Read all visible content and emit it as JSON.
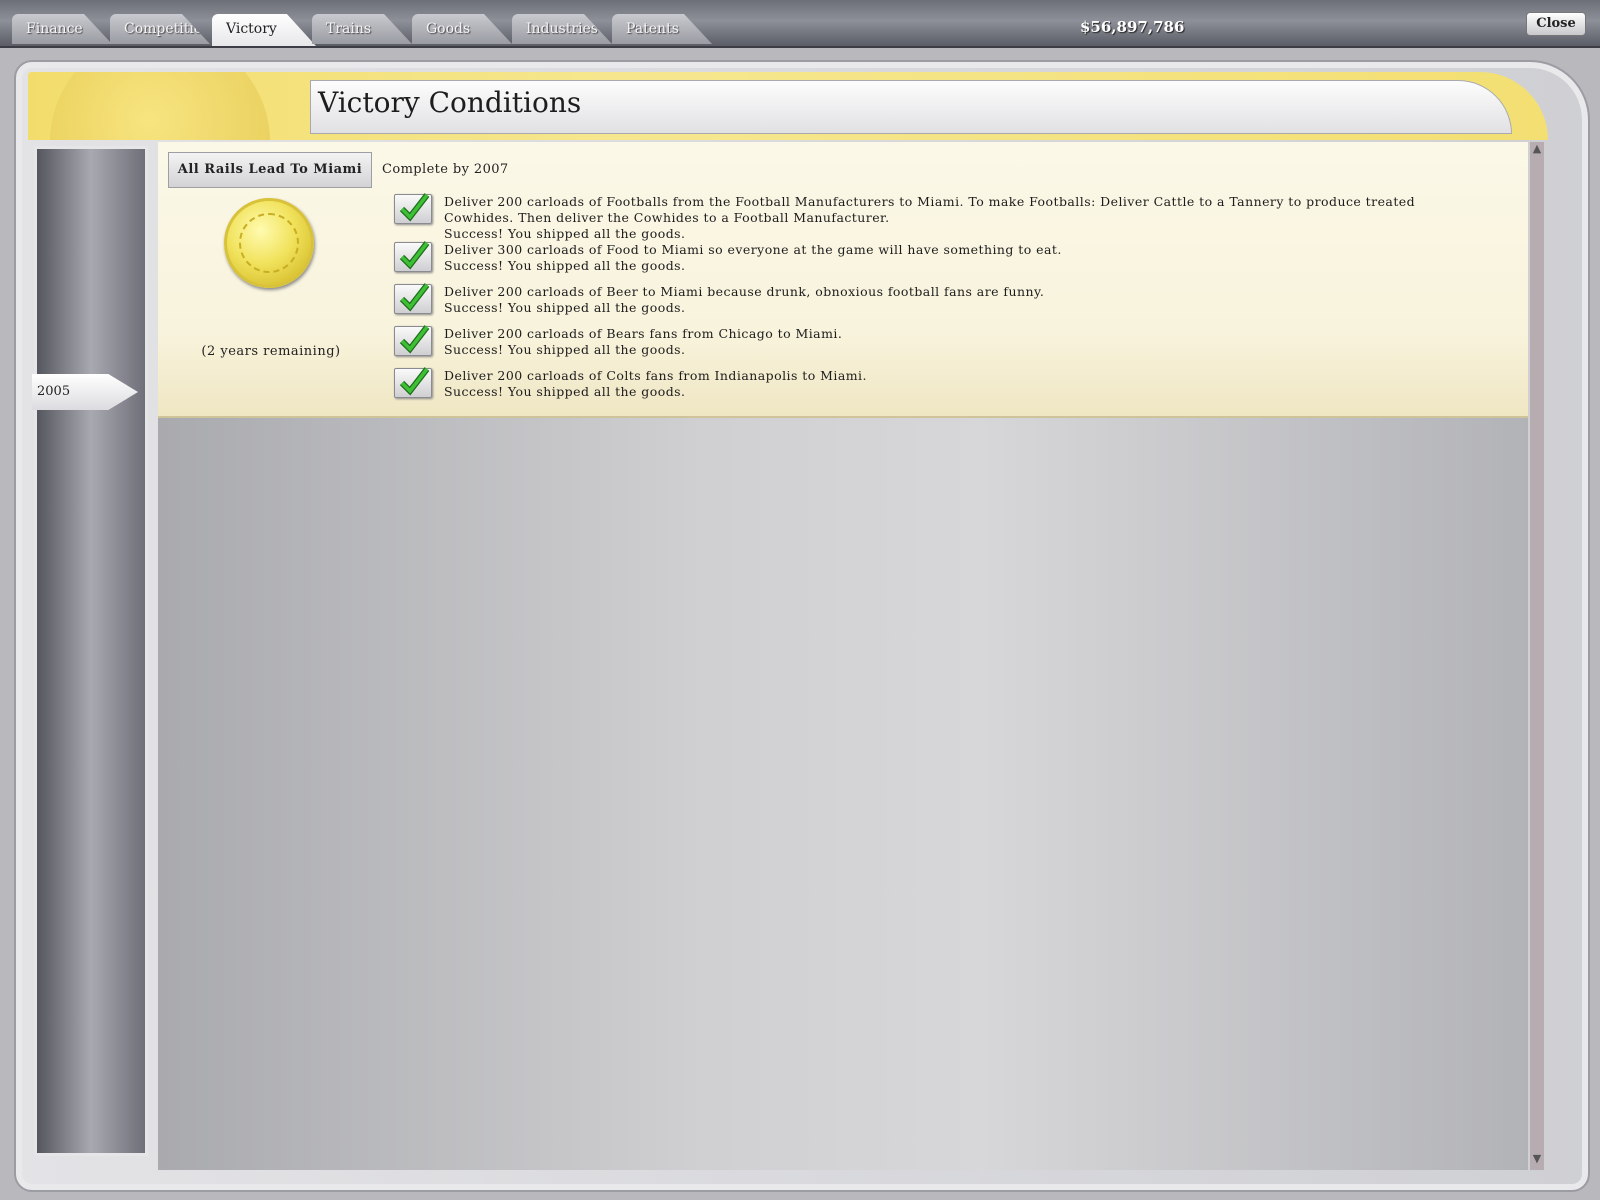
{
  "tabs": [
    {
      "label": "Finance",
      "active": false
    },
    {
      "label": "Competition",
      "active": false
    },
    {
      "label": "Victory",
      "active": true
    },
    {
      "label": "Trains",
      "active": false
    },
    {
      "label": "Goods",
      "active": false
    },
    {
      "label": "Industries",
      "active": false
    },
    {
      "label": "Patents",
      "active": false
    }
  ],
  "header": {
    "money": "$56,897,786",
    "close_label": "Close",
    "title": "Victory Conditions"
  },
  "timeline": {
    "current_year": "2005"
  },
  "scenario": {
    "name": "All Rails Lead To Miami",
    "deadline": "Complete by 2007",
    "remaining": "(2 years remaining)",
    "medal_icon": "gold-medal-icon"
  },
  "conditions": [
    {
      "description": "Deliver 200 carloads of Footballs from the Football Manufacturers to Miami. To make Footballs: Deliver Cattle to a Tannery to produce treated Cowhides. Then deliver the Cowhides to a Football Manufacturer.",
      "status": "Success! You shipped all the goods.",
      "complete": true
    },
    {
      "description": "Deliver 300 carloads of Food to Miami so everyone at the game will have something to eat.",
      "status": "Success! You shipped all the goods.",
      "complete": true
    },
    {
      "description": "Deliver 200 carloads of Beer to Miami because drunk, obnoxious football fans are funny.",
      "status": "Success! You shipped all the goods.",
      "complete": true
    },
    {
      "description": "Deliver 200 carloads of Bears fans from Chicago to Miami.",
      "status": "Success! You shipped all the goods.",
      "complete": true
    },
    {
      "description": "Deliver 200 carloads of Colts fans from Indianapolis to Miami.",
      "status": "Success! You shipped all the goods.",
      "complete": true
    }
  ],
  "colors": {
    "header_gold": "#f2dd6c",
    "panel_cream": "#fbf8e8",
    "check_green": "#2f9c2a"
  }
}
